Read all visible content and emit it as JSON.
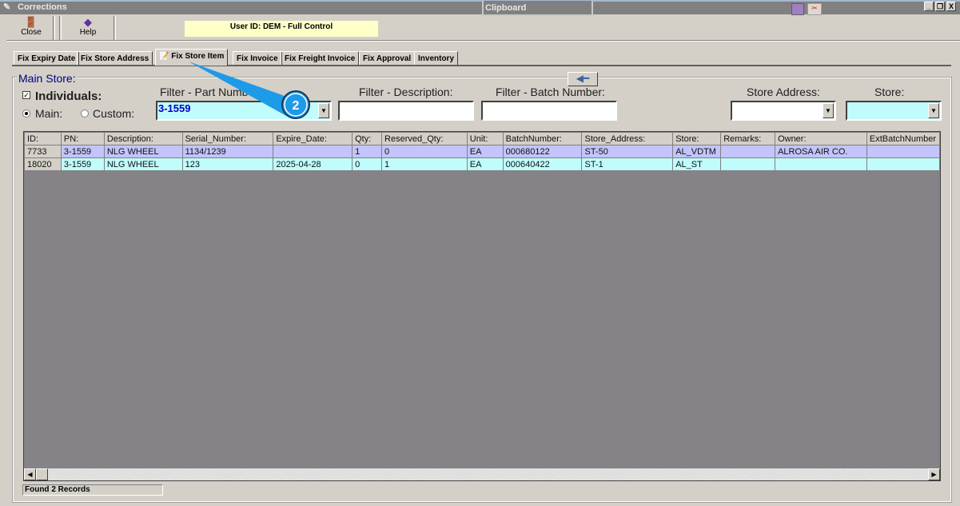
{
  "window": {
    "title": "Corrections",
    "clipboard": "Clipboard",
    "min": "_",
    "restore": "❐",
    "close": "X"
  },
  "toolbar": {
    "close": "Close",
    "help": "Help",
    "user": "User ID: DEM - Full Control"
  },
  "tabs": [
    "Fix Expiry Date",
    "Fix Store Address",
    "Fix Store Item",
    "Fix Invoice",
    "Fix Freight Invoice",
    "Fix Approval",
    "Inventory"
  ],
  "active_tab": "Fix Store Item",
  "group": {
    "title": "Main Store:",
    "individuals": "Individuals:",
    "main": "Main:",
    "custom": "Custom:"
  },
  "filters": {
    "part_label": "Filter - Part Number:",
    "part_value": "3-1559",
    "desc_label": "Filter - Description:",
    "desc_value": "",
    "batch_label": "Filter - Batch Number:",
    "batch_value": "",
    "addr_label": "Store Address:",
    "addr_value": "",
    "store_label": "Store:",
    "store_value": ""
  },
  "callout": "2",
  "table": {
    "columns": [
      "ID:",
      "PN:",
      "Description:",
      "Serial_Number:",
      "Expire_Date:",
      "Qty:",
      "Reserved_Qty:",
      "Unit:",
      "BatchNumber:",
      "Store_Address:",
      "Store:",
      "Remarks:",
      "Owner:",
      "ExtBatchNumber"
    ],
    "rows": [
      [
        "7733",
        "3-1559",
        "NLG WHEEL",
        "1134/1239",
        "",
        "1",
        "0",
        "EA",
        "000680122",
        "ST-50",
        "AL_VDTM",
        "",
        "ALROSA AIR CO.",
        ""
      ],
      [
        "18020",
        "3-1559",
        "NLG WHEEL",
        "123",
        "2025-04-28",
        "0",
        "1",
        "EA",
        "000640422",
        "ST-1",
        "AL_ST",
        "",
        "",
        ""
      ]
    ]
  },
  "status": "Found 2 Records",
  "colors": {
    "accent": "#1e9be8",
    "row_selected": "#c4c4fc",
    "row_alt": "#c0fcfc"
  }
}
